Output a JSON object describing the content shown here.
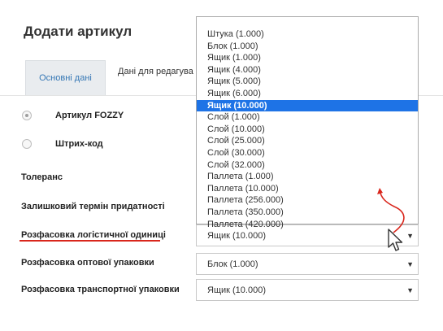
{
  "dialog": {
    "title": "Додати артикул"
  },
  "tabs": [
    {
      "label": "Основні дані"
    },
    {
      "label": "Дані для редагува"
    }
  ],
  "radios": [
    {
      "label": "Артикул FOZZY",
      "checked": true
    },
    {
      "label": "Штрих-код",
      "checked": false
    }
  ],
  "fields": {
    "tolerance": {
      "label": "Толеранс"
    },
    "shelf_life": {
      "label": "Залишковий термін придатності"
    },
    "logistic_unit": {
      "label": "Розфасовка логістичної одиниці",
      "value": "Ящик (10.000)"
    },
    "wholesale": {
      "label": "Розфасовка оптової упаковки",
      "value": "Блок (1.000)"
    },
    "transport": {
      "label": "Розфасовка транспортної упаковки",
      "value": "Ящик (10.000)"
    }
  },
  "dropdown": {
    "options": [
      "Штука (1.000)",
      "Блок (1.000)",
      "Ящик (1.000)",
      "Ящик (4.000)",
      "Ящик (5.000)",
      "Ящик (6.000)",
      "Ящик (10.000)",
      "Слой (1.000)",
      "Слой (10.000)",
      "Слой (25.000)",
      "Слой (30.000)",
      "Слой (32.000)",
      "Паллета (1.000)",
      "Паллета (10.000)",
      "Паллета (256.000)",
      "Паллета (350.000)",
      "Паллета (420.000)"
    ],
    "selected": "Ящик (10.000)"
  },
  "icons": {
    "dropdown_arrow": "▼",
    "cursor": "mouse-pointer-icon",
    "annotation": "red-arrow-icon"
  },
  "colors": {
    "accent": "#1e73e6",
    "tab_text": "#3577b5",
    "underline": "#d9261c"
  }
}
